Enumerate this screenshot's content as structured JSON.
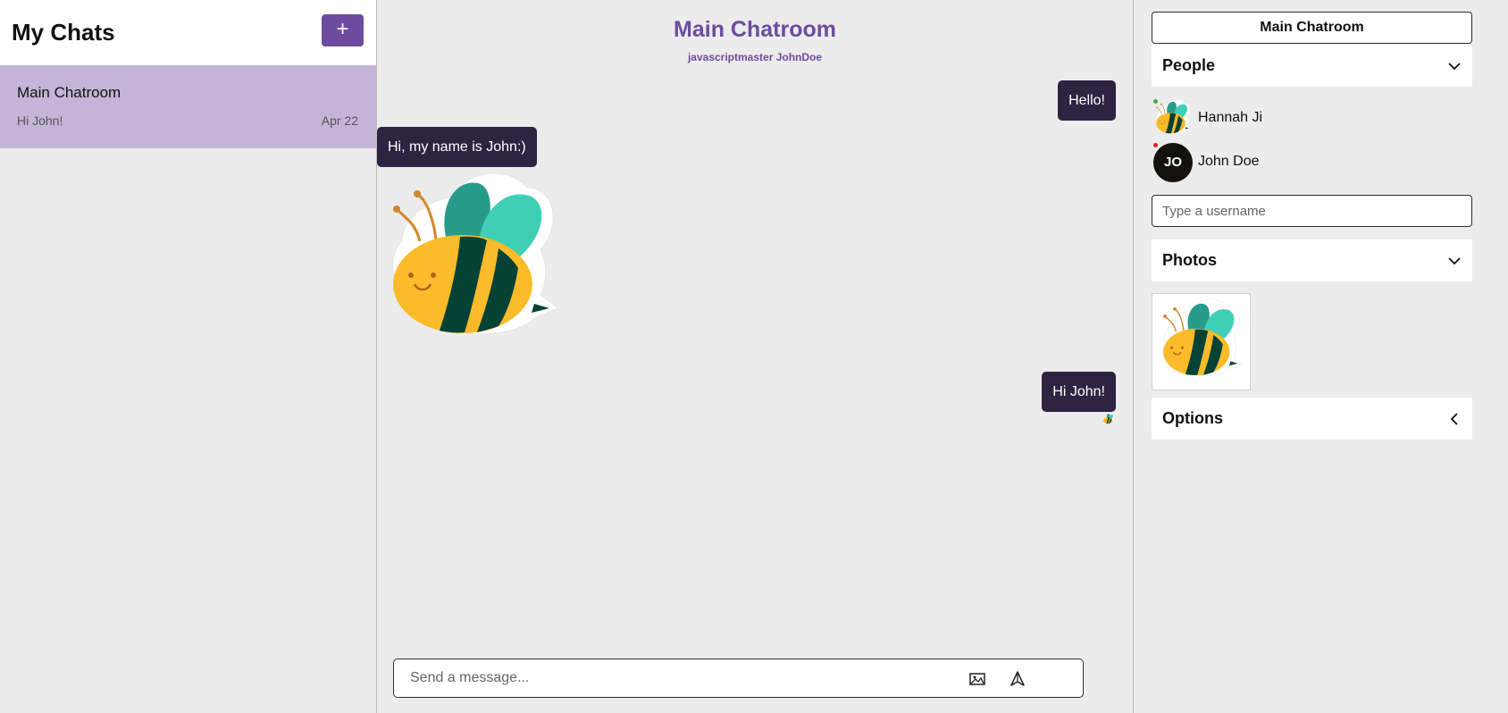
{
  "sidebar": {
    "title": "My Chats",
    "new_chat_label": "+",
    "chats": [
      {
        "title": "Main Chatroom",
        "preview": "Hi John!",
        "date": "Apr 22"
      }
    ]
  },
  "chat": {
    "title": "Main Chatroom",
    "members": "javascriptmaster JohnDoe",
    "messages": [
      {
        "text": "Hello!",
        "side": "right"
      },
      {
        "text": "Hi, my name is John:)",
        "side": "left"
      },
      {
        "sticker": "bee-sticker",
        "side": "left"
      },
      {
        "text": "Hi John!",
        "side": "right"
      }
    ],
    "composer": {
      "placeholder": "Send a message...",
      "value": ""
    }
  },
  "details": {
    "room_button": "Main Chatroom",
    "people_label": "People",
    "people": [
      {
        "name": "Hannah Ji",
        "avatar": "bee-avatar",
        "status_color": "#3cb043"
      },
      {
        "name": "John Doe",
        "initials": "JO",
        "status_color": "#e02020"
      }
    ],
    "username_placeholder": "Type a username",
    "photos_label": "Photos",
    "options_label": "Options"
  },
  "colors": {
    "accent": "#6d4c9f",
    "selected_chat": "#c4b4d8",
    "bubble": "#2f2342"
  }
}
